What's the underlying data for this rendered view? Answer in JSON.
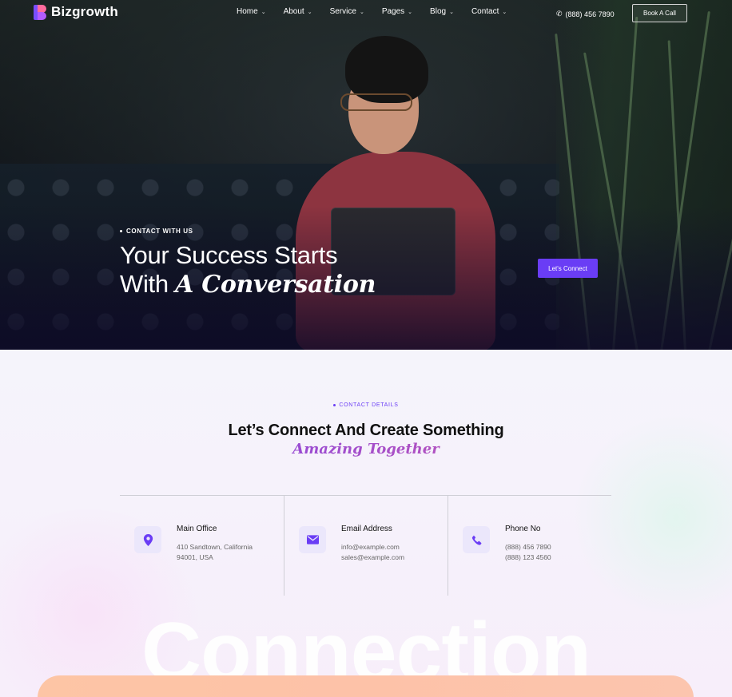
{
  "brand": {
    "name": "Bizgrowth"
  },
  "nav": {
    "items": [
      {
        "label": "Home",
        "chevron": "⌄"
      },
      {
        "label": "About",
        "chevron": "⌄"
      },
      {
        "label": "Service",
        "chevron": "⌄"
      },
      {
        "label": "Pages",
        "chevron": "⌄"
      },
      {
        "label": "Blog",
        "chevron": "⌄"
      },
      {
        "label": "Contact",
        "chevron": "⌄"
      }
    ],
    "phone": "(888) 456 7890",
    "phone_icon": "phone-icon",
    "cta": "Book A Call"
  },
  "hero": {
    "eyebrow": "CONTACT WITH US",
    "title_line1": "Your Success Starts",
    "title_line2_plain": "With",
    "title_line2_italic": "A Conversation",
    "button": "Let's Connect"
  },
  "contact": {
    "eyebrow": "CONTACT DETAILS",
    "title": "Let’s Connect And Create Something",
    "title_italic": "Amazing Together",
    "cards": [
      {
        "icon": "location-pin-icon",
        "title": "Main Office",
        "lines": [
          "410 Sandtown, California",
          "94001, USA"
        ]
      },
      {
        "icon": "envelope-icon",
        "title": "Email Address",
        "lines": [
          "info@example.com",
          "sales@example.com"
        ]
      },
      {
        "icon": "phone-icon",
        "title": "Phone No",
        "lines": [
          "(888) 456 7890",
          "(888) 123 4560"
        ]
      }
    ],
    "watermark": "Connection"
  },
  "colors": {
    "accent": "#6a3df5",
    "gradient_pink": "#e0609f",
    "panel": "#fdc5a5"
  }
}
